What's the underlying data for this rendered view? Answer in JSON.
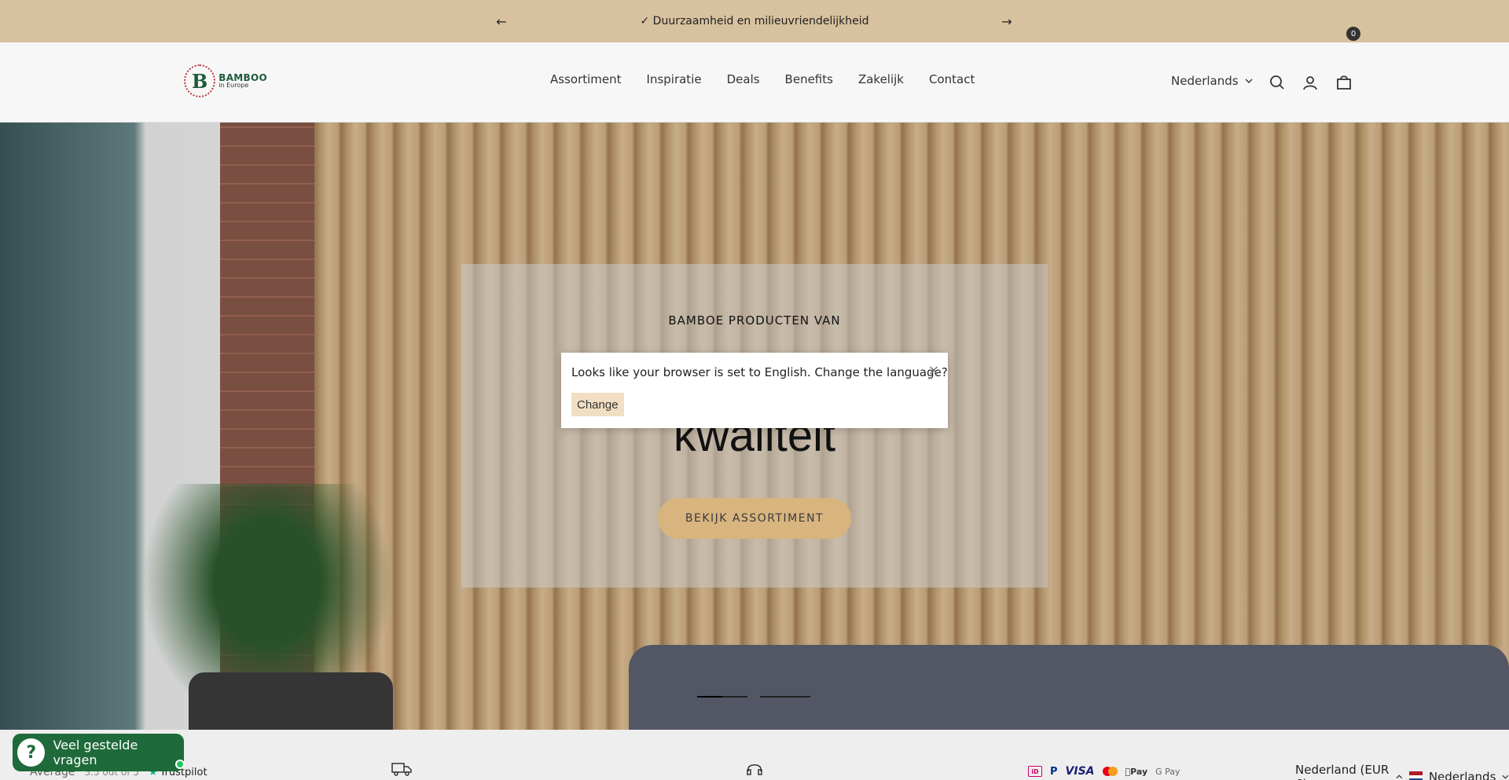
{
  "announcement": {
    "message": "✓ Duurzaamheid en milieuvriendelijkheid",
    "prev_icon": "arrow-left-icon",
    "next_icon": "arrow-right-icon"
  },
  "header": {
    "logo": {
      "mark": "B",
      "line1": "BAMBOO",
      "line2": "in Europe"
    },
    "nav": [
      "Assortiment",
      "Inspiratie",
      "Deals",
      "Benefits",
      "Zakelijk",
      "Contact"
    ],
    "language": "Nederlands",
    "cart_count": "0"
  },
  "hero": {
    "eyebrow": "BAMBOE PRODUCTEN VAN",
    "headline": "kwaliteit",
    "cta": "BEKIJK ASSORTIMENT",
    "slides": 2,
    "active_slide": 1
  },
  "popup": {
    "message": "Looks like your browser is set to English. Change the language?",
    "close": "×",
    "button": "Change"
  },
  "footer_strip": {
    "trustpilot": {
      "label": "Average",
      "rating": "3.5 out of 5",
      "brand": "Trustpilot"
    },
    "payments": {
      "visa": "VISA",
      "applepay": "Pay",
      "googlepay": "G Pay"
    },
    "region": "Nederland (EUR €)",
    "language": "Nederlands"
  },
  "faq_widget": {
    "label": "Veel gestelde vragen",
    "icon": "?"
  },
  "colors": {
    "announce_bg": "#d8c19e",
    "cta_bg": "#d8b47e",
    "faq_bg": "#1e6a3a",
    "change_bg": "#f2dfc3"
  }
}
